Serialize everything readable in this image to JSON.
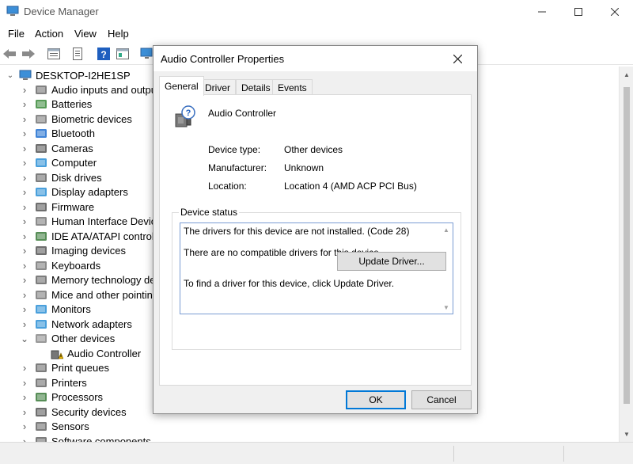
{
  "window": {
    "title": "Device Manager"
  },
  "menu": [
    "File",
    "Action",
    "View",
    "Help"
  ],
  "tree": {
    "root": "DESKTOP-I2HE1SP",
    "items": [
      {
        "label": "Audio inputs and outputs",
        "icon": "speaker-icon",
        "color": "#6b6b6b"
      },
      {
        "label": "Batteries",
        "icon": "battery-icon",
        "color": "#3a8a3a"
      },
      {
        "label": "Biometric devices",
        "icon": "fingerprint-icon",
        "color": "#777777"
      },
      {
        "label": "Bluetooth",
        "icon": "bluetooth-icon",
        "color": "#1e6fd0"
      },
      {
        "label": "Cameras",
        "icon": "camera-icon",
        "color": "#555555"
      },
      {
        "label": "Computer",
        "icon": "computer-icon",
        "color": "#2a8fd6"
      },
      {
        "label": "Disk drives",
        "icon": "disk-drive-icon",
        "color": "#666666"
      },
      {
        "label": "Display adapters",
        "icon": "display-adapter-icon",
        "color": "#2a8fd6"
      },
      {
        "label": "Firmware",
        "icon": "firmware-icon",
        "color": "#555555"
      },
      {
        "label": "Human Interface Devices",
        "icon": "hid-icon",
        "color": "#777777"
      },
      {
        "label": "IDE ATA/ATAPI controllers",
        "icon": "ide-controller-icon",
        "color": "#3a7a3a"
      },
      {
        "label": "Imaging devices",
        "icon": "imaging-device-icon",
        "color": "#555555"
      },
      {
        "label": "Keyboards",
        "icon": "keyboard-icon",
        "color": "#777777"
      },
      {
        "label": "Memory technology devices",
        "icon": "memory-icon",
        "color": "#666666"
      },
      {
        "label": "Mice and other pointing devices",
        "icon": "mouse-icon",
        "color": "#777777"
      },
      {
        "label": "Monitors",
        "icon": "monitor-icon",
        "color": "#2a8fd6"
      },
      {
        "label": "Network adapters",
        "icon": "network-adapter-icon",
        "color": "#2a8fd6"
      },
      {
        "label": "Other devices",
        "icon": "other-devices-icon",
        "color": "#888888"
      },
      {
        "label": "Audio Controller",
        "icon": "warning-device-icon",
        "color": "#e0b000"
      },
      {
        "label": "Print queues",
        "icon": "print-queue-icon",
        "color": "#666666"
      },
      {
        "label": "Printers",
        "icon": "printer-icon",
        "color": "#666666"
      },
      {
        "label": "Processors",
        "icon": "processor-icon",
        "color": "#3a7a3a"
      },
      {
        "label": "Security devices",
        "icon": "security-device-icon",
        "color": "#555555"
      },
      {
        "label": "Sensors",
        "icon": "sensor-icon",
        "color": "#666666"
      },
      {
        "label": "Software components",
        "icon": "software-component-icon",
        "color": "#666666"
      }
    ]
  },
  "dialog": {
    "title": "Audio Controller Properties",
    "tabs": [
      "General",
      "Driver",
      "Details",
      "Events"
    ],
    "device_name": "Audio Controller",
    "properties": [
      {
        "label": "Device type:",
        "value": "Other devices"
      },
      {
        "label": "Manufacturer:",
        "value": "Unknown"
      },
      {
        "label": "Location:",
        "value": "Location 4 (AMD ACP PCI Bus)"
      }
    ],
    "status_group": "Device status",
    "status_lines": [
      "The drivers for this device are not installed. (Code 28)",
      "There are no compatible drivers for this device.",
      "To find a driver for this device, click Update Driver."
    ],
    "update_button": "Update Driver...",
    "ok_button": "OK",
    "cancel_button": "Cancel"
  }
}
